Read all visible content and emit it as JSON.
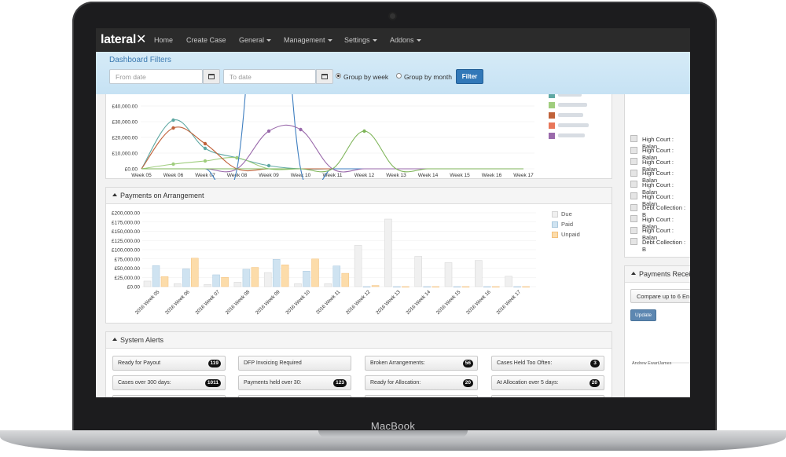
{
  "device": {
    "brand": "MacBook"
  },
  "navbar": {
    "logo": "lateral",
    "items": [
      {
        "label": "Home",
        "dropdown": false
      },
      {
        "label": "Create Case",
        "dropdown": false
      },
      {
        "label": "General",
        "dropdown": true
      },
      {
        "label": "Management",
        "dropdown": true
      },
      {
        "label": "Settings",
        "dropdown": true
      },
      {
        "label": "Addons",
        "dropdown": true
      }
    ]
  },
  "filters": {
    "title": "Dashboard Filters",
    "from_placeholder": "From date",
    "to_placeholder": "To date",
    "group_by_week": "Group by week",
    "group_by_month": "Group by month",
    "selected": "week",
    "filter_button": "Filter"
  },
  "line_panel": {
    "chart_data": {
      "type": "line",
      "categories": [
        "Week 05",
        "Week 06",
        "Week 07",
        "Week 08",
        "Week 09",
        "Week 10",
        "Week 11",
        "Week 12",
        "Week 13",
        "Week 14",
        "Week 15",
        "Week 16",
        "Week 17"
      ],
      "ytick_labels": [
        "£0.00",
        "£10,000.00",
        "£20,000.00",
        "£30,000.00",
        "£40,000.00",
        "£50,000.00"
      ],
      "ylim": [
        0,
        55000
      ],
      "series": [
        {
          "color": "#5fa8a3",
          "values": [
            0,
            31000,
            13000,
            7000,
            2000,
            0,
            0,
            0,
            0,
            0,
            0,
            0,
            0
          ]
        },
        {
          "color": "#9fcd7d",
          "values": [
            0,
            3000,
            5000,
            7000,
            0,
            0,
            0,
            0,
            0,
            0,
            0,
            0,
            0
          ]
        },
        {
          "color": "#c0623a",
          "values": [
            0,
            26000,
            16000,
            0,
            0,
            0,
            0,
            0,
            0,
            0,
            0,
            0,
            0
          ]
        },
        {
          "color": "#3f7fc0",
          "values": [
            0,
            0,
            0,
            0,
            200000,
            0,
            0,
            0,
            0,
            0,
            0,
            0,
            0
          ]
        },
        {
          "color": "#9a6aab",
          "values": [
            0,
            0,
            0,
            0,
            24000,
            25000,
            0,
            0,
            0,
            0,
            0,
            0,
            0
          ]
        },
        {
          "color": "#7fb55a",
          "values": [
            0,
            0,
            0,
            0,
            0,
            0,
            0,
            24000,
            0,
            0,
            0,
            0,
            0
          ]
        }
      ]
    },
    "legend_colors": [
      "#5fa8a3",
      "#9fcd7d",
      "#c0623a",
      "#e8775a",
      "#9a6aab"
    ]
  },
  "bar_panel": {
    "title": "Payments on Arrangement",
    "chart_data": {
      "type": "bar",
      "categories": [
        "2016 Week 05",
        "2016 Week 06",
        "2016 Week 07",
        "2016 Week 08",
        "2016 Week 09",
        "2016 Week 10",
        "2016 Week 11",
        "2016 Week 12",
        "2016 Week 13",
        "2016 Week 14",
        "2016 Week 15",
        "2016 Week 16",
        "2016 Week 17"
      ],
      "ytick_labels": [
        "£0.00",
        "£25,000.00",
        "£50,000.00",
        "£75,000.00",
        "£100,000.00",
        "£125,000.00",
        "£150,000.00",
        "£175,000.00",
        "£200,000.00"
      ],
      "ylim": [
        0,
        200000
      ],
      "series": [
        {
          "name": "Due",
          "color": "#f0f0f0",
          "stroke": "#d4d4d4",
          "values": [
            15000,
            8000,
            6000,
            12000,
            38000,
            8000,
            8000,
            112000,
            183000,
            82000,
            65000,
            71000,
            28000
          ]
        },
        {
          "name": "Paid",
          "color": "#cfe3f1",
          "stroke": "#a9c8de",
          "values": [
            57000,
            48000,
            32000,
            47000,
            74000,
            42000,
            56000,
            0,
            0,
            0,
            0,
            0,
            0
          ]
        },
        {
          "name": "Unpaid",
          "color": "#fcdcaa",
          "stroke": "#f3c07a",
          "values": [
            27000,
            77000,
            25000,
            52000,
            59000,
            75000,
            36000,
            3000,
            0,
            0,
            0,
            0,
            0
          ]
        }
      ]
    }
  },
  "alerts": {
    "title": "System Alerts",
    "items": [
      {
        "label": "Ready for Payout",
        "count": "119"
      },
      {
        "label": "DFP Invoicing Required",
        "count": ""
      },
      {
        "label": "Broken Arrangements:",
        "count": "56"
      },
      {
        "label": "Cases Held Too Often:",
        "count": "3"
      },
      {
        "label": "Cases over 300 days:",
        "count": "1011"
      },
      {
        "label": "Payments held over 30:",
        "count": "123"
      },
      {
        "label": "Ready for Allocation:",
        "count": "20"
      },
      {
        "label": "At Allocation over 5 days:",
        "count": "20"
      }
    ]
  },
  "right_column": {
    "rows": [
      "High Court : Balan",
      "High Court : Balan",
      "High Court : Balan",
      "High Court : Balan",
      "High Court : Balan",
      "High Court : Balan",
      "Debt Collection : B",
      "High Court : Balan",
      "High Court : Balan",
      "Debt Collection : B"
    ],
    "payments_received_title": "Payments Receive",
    "compare_label": "Compare up to 6 En",
    "update_button": "Update",
    "name_label": "Andrew EwartJames"
  }
}
